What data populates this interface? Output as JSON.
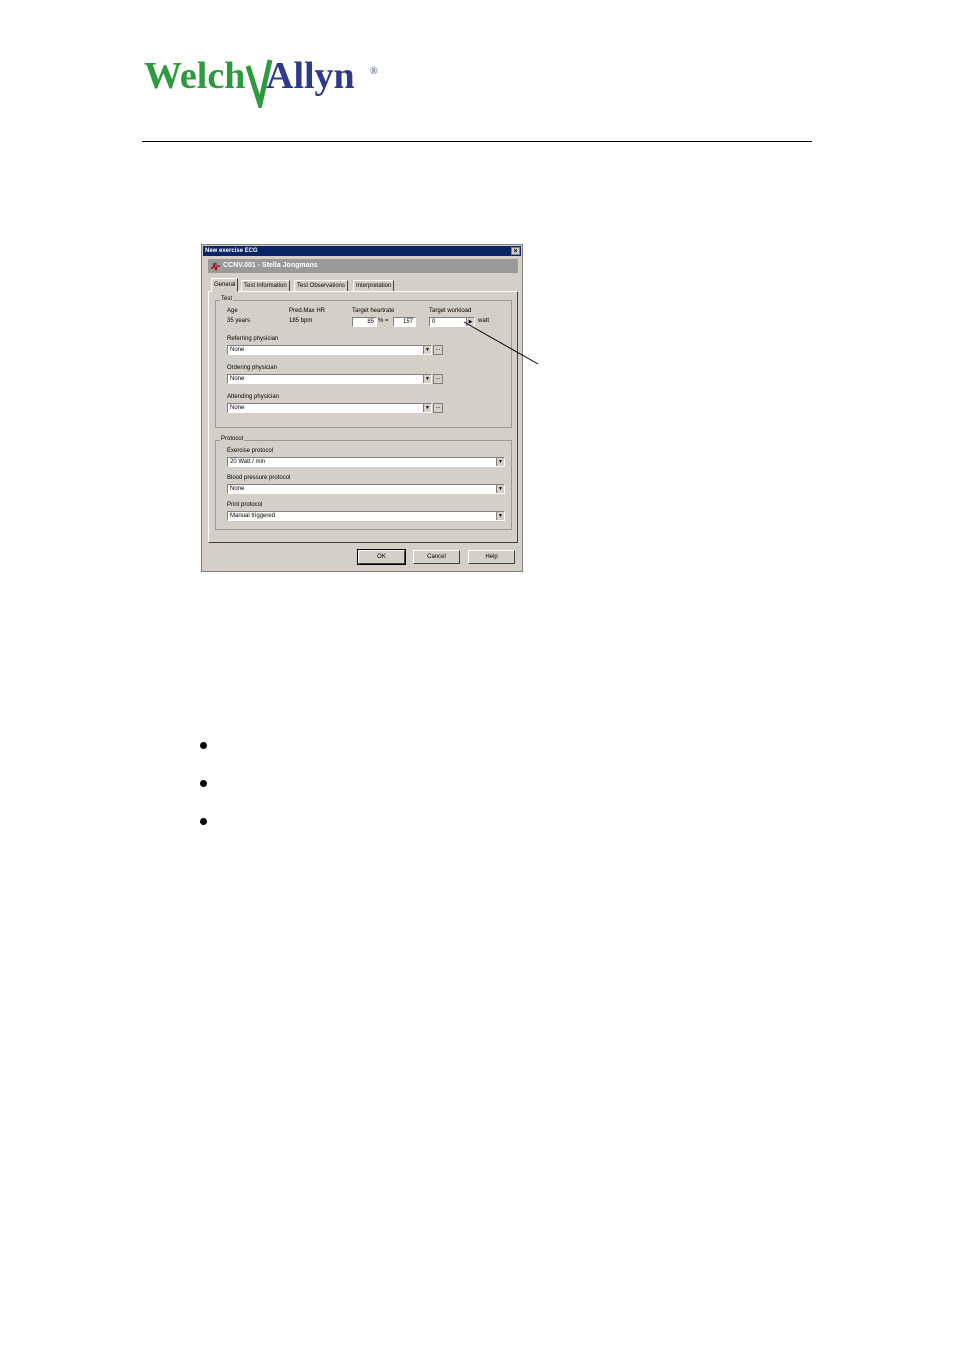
{
  "logo": {
    "text_welch": "Welch",
    "text_allyn": "Allyn",
    "registered": "®",
    "colors": {
      "welch": "#2e9a3e",
      "allyn": "#2d3a8c"
    }
  },
  "dialog": {
    "title": "New exercise ECG",
    "close_glyph": "×",
    "patient_name": "CCNV.001 - Stella Jongmans",
    "tabs": [
      {
        "label": "General",
        "active": true
      },
      {
        "label": "Test Information",
        "active": false
      },
      {
        "label": "Test Observations",
        "active": false
      },
      {
        "label": "Interpretation",
        "active": false
      }
    ],
    "test_group": {
      "title": "Test",
      "age_label": "Age",
      "age_value": "35 years",
      "pred_label": "Pred.Max HR",
      "pred_value": "185 bpm",
      "target_hr_label": "Target heartrate",
      "target_hr_percent": "85",
      "percent_eq": "% =",
      "target_hr_bpm": "157",
      "target_workload_label": "Target workload",
      "target_workload_value": "0",
      "workload_unit": "watt",
      "referring_label": "Referring physician",
      "referring_value": "None",
      "ordering_label": "Ordering physician",
      "ordering_value": "None",
      "attending_label": "Attending physician",
      "attending_value": "None",
      "ellipsis": "..."
    },
    "protocol_group": {
      "title": "Protocol",
      "exercise_label": "Exercise protocol",
      "exercise_value": "20 Watt / min",
      "bp_label": "Blood pressure protocol",
      "bp_value": "None",
      "print_label": "Print protocol",
      "print_value": "Manual triggered"
    },
    "buttons": {
      "ok": "OK",
      "cancel": "Cancel",
      "help": "Help"
    }
  }
}
